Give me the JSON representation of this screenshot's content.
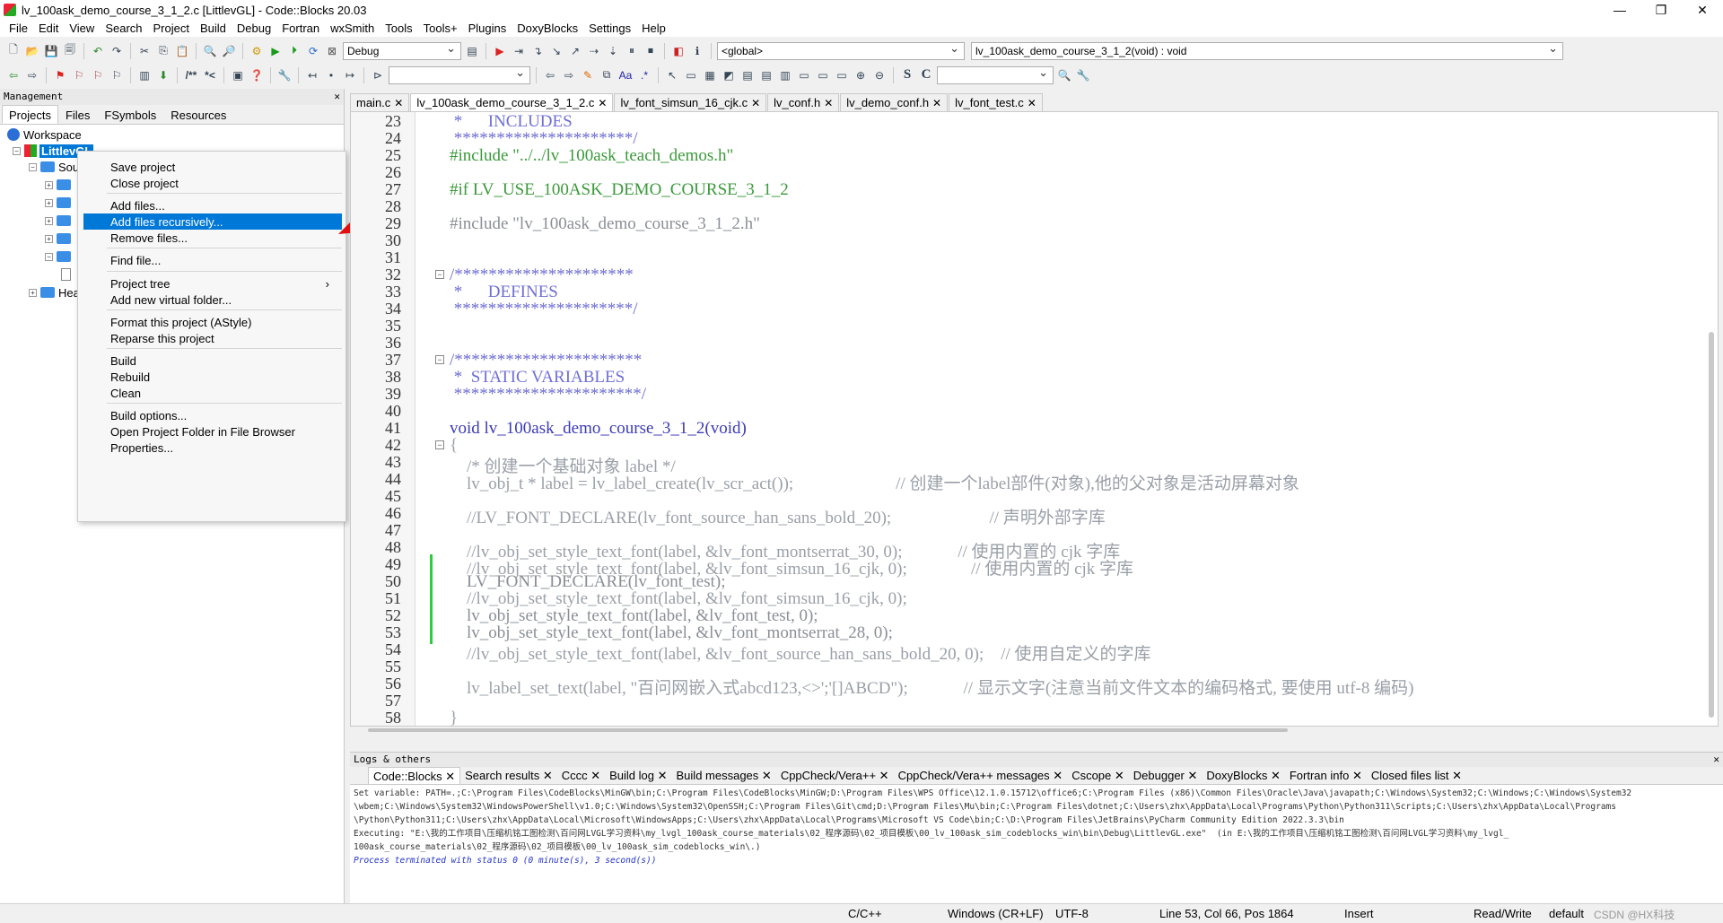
{
  "window": {
    "title": "lv_100ask_demo_course_3_1_2.c [LittlevGL] - Code::Blocks 20.03",
    "minimize": "—",
    "maximize": "❐",
    "close": "✕"
  },
  "menu": [
    "File",
    "Edit",
    "View",
    "Search",
    "Project",
    "Build",
    "Debug",
    "Fortran",
    "wxSmith",
    "Tools",
    "Tools+",
    "Plugins",
    "DoxyBlocks",
    "Settings",
    "Help"
  ],
  "toolbar": {
    "build_target": "Debug",
    "scope": "<global>",
    "function": "lv_100ask_demo_course_3_1_2(void) : void",
    "search_value": "",
    "jump_value": ""
  },
  "management": {
    "title": "Management",
    "close": "✕",
    "tabs": [
      "Projects",
      "Files",
      "FSymbols",
      "Resources"
    ],
    "workspace": "Workspace",
    "project": "LittlevGL",
    "sources_folder": "Sources",
    "headers_folder": "Headers"
  },
  "context_menu": {
    "items": [
      {
        "label": "Save project"
      },
      {
        "label": "Close project"
      },
      {
        "label": "Add files..."
      },
      {
        "label": "Add files recursively..."
      },
      {
        "label": "Remove files..."
      },
      {
        "label": "Find file..."
      },
      {
        "label": "Project tree",
        "submenu": "›"
      },
      {
        "label": "Add new virtual folder..."
      },
      {
        "label": "Format this project (AStyle)"
      },
      {
        "label": "Reparse this project"
      },
      {
        "label": "Build"
      },
      {
        "label": "Rebuild"
      },
      {
        "label": "Clean"
      },
      {
        "label": "Build options..."
      },
      {
        "label": "Open Project Folder in File Browser"
      },
      {
        "label": "Properties..."
      }
    ],
    "highlighted": "Add files recursively..."
  },
  "editor_tabs": [
    {
      "label": "main.c",
      "active": false
    },
    {
      "label": "lv_100ask_demo_course_3_1_2.c",
      "active": true
    },
    {
      "label": "lv_font_simsun_16_cjk.c",
      "active": false
    },
    {
      "label": "lv_conf.h",
      "active": false
    },
    {
      "label": "lv_demo_conf.h",
      "active": false
    },
    {
      "label": "lv_font_test.c",
      "active": false
    }
  ],
  "code_lines": [
    {
      "n": "23",
      "t": " *      INCLUDES",
      "c": "cm"
    },
    {
      "n": "24",
      "t": " *********************/",
      "c": "cm"
    },
    {
      "n": "25",
      "t": "#include \"../../lv_100ask_teach_demos.h\"",
      "c": "pp"
    },
    {
      "n": "26",
      "t": "",
      "c": ""
    },
    {
      "n": "27",
      "t": "#if LV_USE_100ASK_DEMO_COURSE_3_1_2",
      "c": "pp"
    },
    {
      "n": "28",
      "t": "",
      "c": ""
    },
    {
      "n": "29",
      "t": "#include \"lv_100ask_demo_course_3_1_2.h\"",
      "c": "grey"
    },
    {
      "n": "30",
      "t": "",
      "c": ""
    },
    {
      "n": "31",
      "t": "",
      "c": ""
    },
    {
      "n": "32",
      "t": "/*********************",
      "c": "cm"
    },
    {
      "n": "33",
      "t": " *      DEFINES",
      "c": "cm"
    },
    {
      "n": "34",
      "t": " *********************/",
      "c": "cm"
    },
    {
      "n": "35",
      "t": "",
      "c": ""
    },
    {
      "n": "36",
      "t": "",
      "c": ""
    },
    {
      "n": "37",
      "t": "/**********************",
      "c": "cm"
    },
    {
      "n": "38",
      "t": " *  STATIC VARIABLES",
      "c": "cm"
    },
    {
      "n": "39",
      "t": " **********************/",
      "c": "cm"
    },
    {
      "n": "40",
      "t": "",
      "c": ""
    },
    {
      "n": "41",
      "t": "void lv_100ask_demo_course_3_1_2(void)",
      "c": "kw"
    },
    {
      "n": "42",
      "t": "{",
      "c": "faded"
    },
    {
      "n": "43",
      "t": "    /* 创建一个基础对象 label */",
      "c": "faded"
    },
    {
      "n": "44",
      "t": "    lv_obj_t * label = lv_label_create(lv_scr_act());                        // 创建一个label部件(对象),他的父对象是活动屏幕对象",
      "c": "faded"
    },
    {
      "n": "45",
      "t": "",
      "c": ""
    },
    {
      "n": "46",
      "t": "    //LV_FONT_DECLARE(lv_font_source_han_sans_bold_20);                       // 声明外部字库",
      "c": "faded"
    },
    {
      "n": "47",
      "t": "",
      "c": ""
    },
    {
      "n": "48",
      "t": "    //lv_obj_set_style_text_font(label, &lv_font_montserrat_30, 0);             // 使用内置的 cjk 字库",
      "c": "faded"
    },
    {
      "n": "49",
      "t": "    //lv_obj_set_style_text_font(label, &lv_font_simsun_16_cjk, 0);               // 使用内置的 cjk 字库",
      "c": "faded"
    },
    {
      "n": "50",
      "t": "    LV_FONT_DECLARE(lv_font_test);",
      "c": "grey"
    },
    {
      "n": "51",
      "t": "    //lv_obj_set_style_text_font(label, &lv_font_simsun_16_cjk, 0);",
      "c": "faded"
    },
    {
      "n": "52",
      "t": "    lv_obj_set_style_text_font(label, &lv_font_test, 0);",
      "c": "grey"
    },
    {
      "n": "53",
      "t": "    lv_obj_set_style_text_font(label, &lv_font_montserrat_28, 0);",
      "c": "grey"
    },
    {
      "n": "54",
      "t": "    //lv_obj_set_style_text_font(label, &lv_font_source_han_sans_bold_20, 0);    // 使用自定义的字库",
      "c": "faded"
    },
    {
      "n": "55",
      "t": "",
      "c": ""
    },
    {
      "n": "56",
      "t": "    lv_label_set_text(label, \"百问网嵌入式abcd123,<>';'[]ABCD\");             // 显示文字(注意当前文件文本的编码格式, 要使用 utf-8 编码)",
      "c": "faded"
    },
    {
      "n": "57",
      "t": "",
      "c": ""
    },
    {
      "n": "58",
      "t": "}",
      "c": "faded"
    }
  ],
  "logs": {
    "title": "Logs & others",
    "close": "✕",
    "tabs": [
      "Code::Blocks",
      "Search results",
      "Cccc",
      "Build log",
      "Build messages",
      "CppCheck/Vera++",
      "CppCheck/Vera++ messages",
      "Cscope",
      "Debugger",
      "DoxyBlocks",
      "Fortran info",
      "Closed files list"
    ],
    "lines": [
      "Set variable: PATH=.;C:\\Program Files\\CodeBlocks\\MinGW\\bin;C:\\Program Files\\CodeBlocks\\MinGW;D:\\Program Files\\WPS Office\\12.1.0.15712\\office6;C:\\Program Files (x86)\\Common Files\\Oracle\\Java\\javapath;C:\\Windows\\System32;C:\\Windows;C:\\Windows\\System32",
      "\\wbem;C:\\Windows\\System32\\WindowsPowerShell\\v1.0;C:\\Windows\\System32\\OpenSSH;C:\\Program Files\\Git\\cmd;D:\\Program Files\\Mu\\bin;C:\\Program Files\\dotnet;C:\\Users\\zhx\\AppData\\Local\\Programs\\Python\\Python311\\Scripts;C:\\Users\\zhx\\AppData\\Local\\Programs",
      "\\Python\\Python311;C:\\Users\\zhx\\AppData\\Local\\Microsoft\\WindowsApps;C:\\Users\\zhx\\AppData\\Local\\Programs\\Microsoft VS Code\\bin;C:\\D:\\Program Files\\JetBrains\\PyCharm Community Edition 2022.3.3\\bin",
      "Executing: \"E:\\我的工作项目\\压缩机铭工图检测\\百问网LVGL学习资料\\my_lvgl_100ask_course_materials\\02_程序源码\\02_项目模板\\00_lv_100ask_sim_codeblocks_win\\bin\\Debug\\LittlevGL.exe\"  (in E:\\我的工作项目\\压缩机铭工图检测\\百问网LVGL学习资料\\my_lvgl_",
      "100ask_course_materials\\02_程序源码\\02_项目模板\\00_lv_100ask_sim_codeblocks_win\\.)"
    ],
    "final": "Process terminated with status 0 (0 minute(s), 3 second(s))"
  },
  "statusbar": {
    "lang": "C/C++",
    "eol": "Windows (CR+LF)",
    "enc": "UTF-8",
    "pos": "Line 53, Col 66, Pos 1864",
    "mode": "Insert",
    "rw": "Read/Write",
    "profile": "default",
    "watermark": "CSDN @HX科技"
  }
}
